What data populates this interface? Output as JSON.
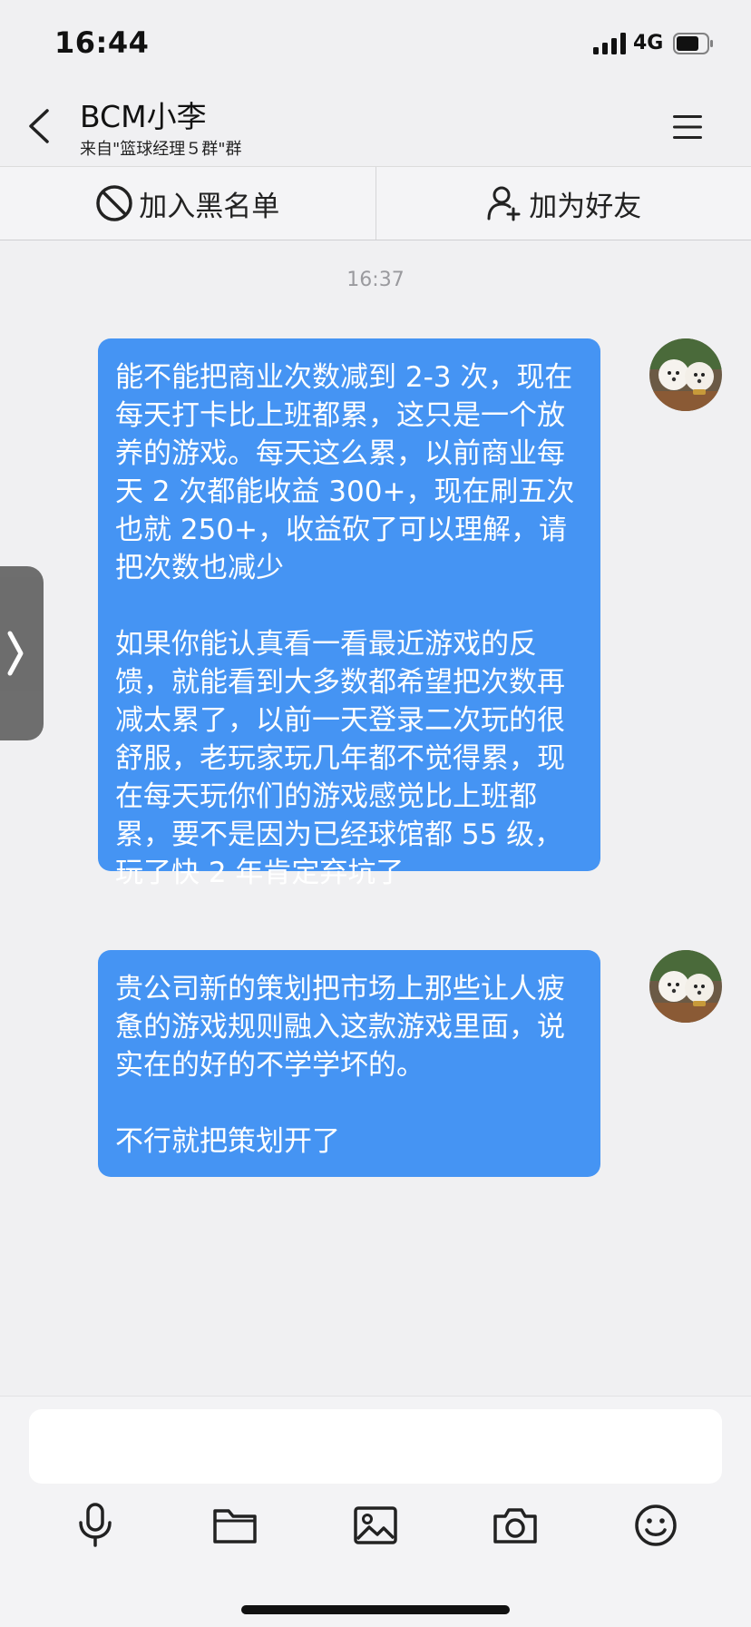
{
  "status_bar": {
    "time": "16:44",
    "network": "4G"
  },
  "header": {
    "title": "BCM小李",
    "subtitle": "来自\"篮球经理５群\"群"
  },
  "actions": {
    "block_label": "加入黑名单",
    "add_friend_label": "加为好友"
  },
  "chat": {
    "timestamp": "16:37",
    "messages": [
      {
        "text": "能不能把商业次数减到 2-3 次，现在每天打卡比上班都累，这只是一个放养的游戏。每天这么累，以前商业每天 2 次都能收益 300+，现在刷五次也就 250+，收益砍了可以理解，请把次数也减少\n\n如果你能认真看一看最近游戏的反馈，就能看到大多数都希望把次数再减太累了，以前一天登录二次玩的很舒服，老玩家玩几年都不觉得累，现在每天玩你们的游戏感觉比上班都累，要不是因为已经球馆都 55 级，玩了快 2 年肯定弃坑了"
      },
      {
        "text": "贵公司新的策划把市场上那些让人疲惫的游戏规则融入这款游戏里面，说实在的好的不学学坏的。\n\n不行就把策划开了"
      }
    ]
  },
  "input": {
    "value": "",
    "placeholder": ""
  },
  "icons": {
    "bubble_color": "#4594f3",
    "toolbar": [
      "microphone-icon",
      "folder-icon",
      "image-icon",
      "camera-icon",
      "emoji-icon"
    ]
  }
}
